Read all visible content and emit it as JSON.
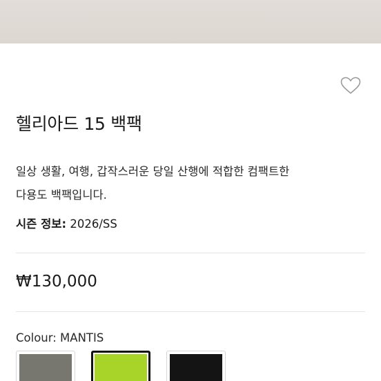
{
  "product": {
    "title": "헬리아드 15 백팩",
    "description_lines": [
      "일상 생활, 여행, 갑작스러운 당일 산행에 적합한 컴팩트한",
      "다용도 백팩입니다."
    ],
    "season_label": "시즌 정보:",
    "season_value": " 2026/SS",
    "price": "₩130,000"
  },
  "colour": {
    "label": "Colour: MANTIS",
    "swatches": [
      {
        "name": "grey",
        "color": "#77766f",
        "selected": false
      },
      {
        "name": "mantis",
        "color": "#a8d42a",
        "selected": true
      },
      {
        "name": "black",
        "color": "#141414",
        "selected": false
      }
    ]
  },
  "icons": {
    "wishlist": "heart-outline-icon"
  },
  "colors": {
    "image_background": "#ddd7d2",
    "divider": "#e3e3e3"
  }
}
